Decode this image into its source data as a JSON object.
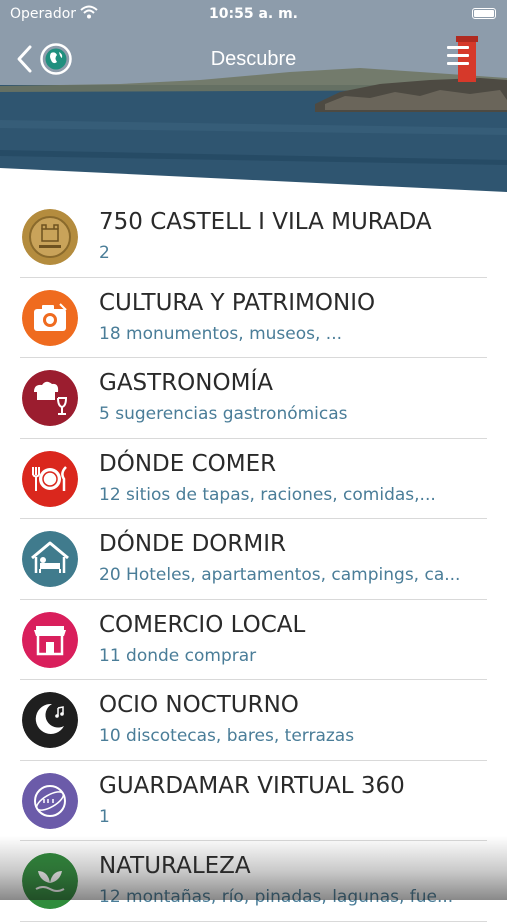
{
  "status_bar": {
    "carrier": "Operador",
    "time": "10:55 a. m."
  },
  "header": {
    "title": "Descubre"
  },
  "items": [
    {
      "title": "750 CASTELL I VILA MURADA",
      "subtitle": "2",
      "icon": "castle-seal-icon",
      "color": "#b0893a"
    },
    {
      "title": "CULTURA Y PATRIMONIO",
      "subtitle": "18 monumentos, museos, ...",
      "icon": "camera-icon",
      "color": "#ee6a1e"
    },
    {
      "title": "GASTRONOMÍA",
      "subtitle": "5 sugerencias gastronómicas",
      "icon": "chef-hat-wine-icon",
      "color": "#9a1c2e"
    },
    {
      "title": "DÓNDE COMER",
      "subtitle": "12 sitios de tapas, raciones, comidas,...",
      "icon": "plate-cutlery-icon",
      "color": "#d9261c"
    },
    {
      "title": "DÓNDE DORMIR",
      "subtitle": "20 Hoteles, apartamentos, campings, ca...",
      "icon": "house-bed-icon",
      "color": "#3f7a8c"
    },
    {
      "title": "COMERCIO LOCAL",
      "subtitle": "11 donde comprar",
      "icon": "shop-icon",
      "color": "#d81e5b"
    },
    {
      "title": "OCIO NOCTURNO",
      "subtitle": "10 discotecas, bares, terrazas",
      "icon": "moon-music-icon",
      "color": "#1e1e1e"
    },
    {
      "title": "GUARDAMAR VIRTUAL 360",
      "subtitle": "1",
      "icon": "virtual-360-icon",
      "color": "#6a5aa8"
    },
    {
      "title": "NATURALEZA",
      "subtitle": "12 montañas, río, pinadas, lagunas, fue...",
      "icon": "leaf-icon",
      "color": "#2e8b3a"
    }
  ]
}
